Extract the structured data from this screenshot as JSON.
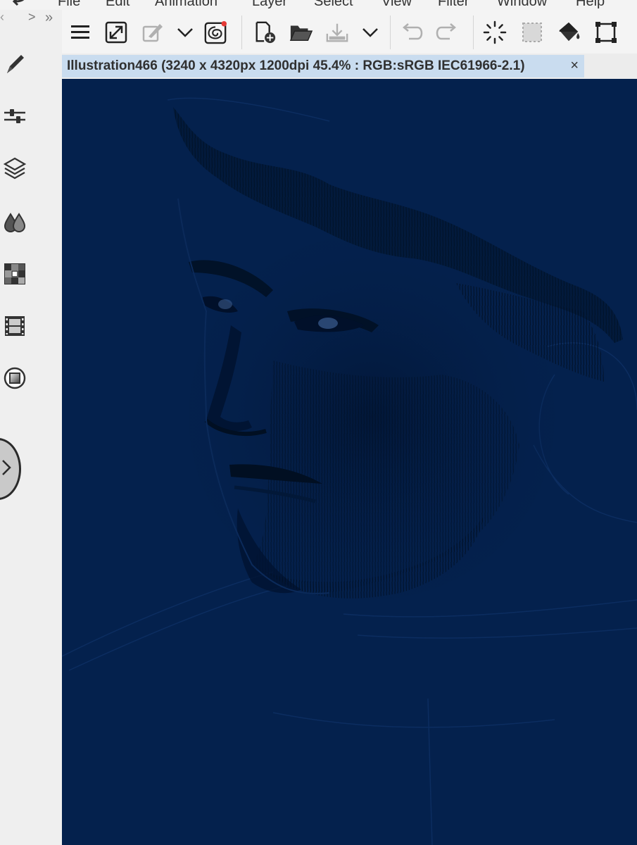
{
  "menubar": {
    "items": [
      "File",
      "Edit",
      "Animation",
      "Layer",
      "Select",
      "View",
      "Filter",
      "Window",
      "Help"
    ]
  },
  "toolbar": {
    "buttons": [
      {
        "name": "menu-icon"
      },
      {
        "name": "canvas-resize-icon"
      },
      {
        "name": "transform-pen-icon"
      },
      {
        "name": "chevron-down-icon"
      },
      {
        "name": "cloud-sync-icon",
        "notification": true
      },
      {
        "name": "new-document-icon"
      },
      {
        "name": "open-folder-icon"
      },
      {
        "name": "save-icon"
      },
      {
        "name": "chevron-down-icon"
      },
      {
        "name": "undo-icon"
      },
      {
        "name": "redo-icon"
      },
      {
        "name": "loading-spinner-icon"
      },
      {
        "name": "selection-clear-icon"
      },
      {
        "name": "fill-bucket-icon"
      },
      {
        "name": "transform-icon"
      }
    ]
  },
  "sidebar": {
    "collapse_left": ">",
    "collapse_right": "»",
    "items": [
      {
        "name": "brush-tool-icon"
      },
      {
        "name": "tool-property-icon"
      },
      {
        "name": "layers-icon"
      },
      {
        "name": "color-drops-icon"
      },
      {
        "name": "color-palette-icon"
      },
      {
        "name": "timeline-icon"
      },
      {
        "name": "navigator-icon"
      }
    ]
  },
  "document": {
    "tab_title": "Illustration466 (3240 x 4320px 1200dpi 45.4% : RGB:sRGB IEC61966-2.1)",
    "close": "×"
  },
  "colors": {
    "canvas_background": "#04214d",
    "tab_active": "#c9dcef",
    "notification_dot": "#e53935"
  }
}
